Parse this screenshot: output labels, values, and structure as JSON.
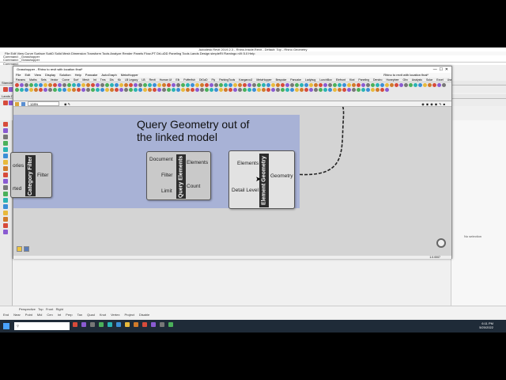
{
  "rhino": {
    "title": "Autodesk Revit 2019.2.3 - Rhino.Inside.Revit - Default: Top - Rhino Geometry",
    "menu": "File  Edit  View  Curve  Surface  SubD  Solid  Mesh  Dimension  Transform  Tools  Analyze  Render  Panels  Flow-PT  DrLuDD  Paneling Tools  Lands Design  simpleRI  Flamingo nXt 5.0  Help",
    "cmd_history": [
      "Command: _Grasshopper",
      "Command: _Grasshopper"
    ],
    "cmd_prompt": "Command:",
    "tabs": [
      "Standard",
      "CPlanes",
      "Set View",
      "Display",
      "Select",
      "Viewport Layout",
      "Visibility",
      "Transform",
      "Curve Tools",
      "Surface Tools",
      "Solid Tools",
      "SubD Tools",
      "Mesh Tools",
      "Render Tools",
      "Drafting",
      "New in V7"
    ],
    "subtabs": [
      "Lands Design",
      "Lands Objects",
      "Lands Documentation",
      "Lands Tools"
    ],
    "right_panel_text": "No selection",
    "osnap": [
      "End",
      "Near",
      "Point",
      "Mid",
      "Cen",
      "Int",
      "Perp",
      "Tan",
      "Quad",
      "Knot",
      "Vertex",
      "Project",
      "Disable"
    ],
    "view_tabs": [
      "Perspective",
      "Top",
      "Front",
      "Right"
    ],
    "clock": {
      "time": "6:11 PM",
      "date": "5/20/2022"
    }
  },
  "gh": {
    "title": "Grasshopper - Rhino to revit with location final*",
    "doc_name": "Rhino to revit with location final*",
    "menu": [
      "File",
      "Edit",
      "View",
      "Display",
      "Solution",
      "Help",
      "Pancake",
      "AutoGraph",
      "MetaHopper"
    ],
    "tabs": [
      "Params",
      "Maths",
      "Sets",
      "Vector",
      "Curve",
      "Surf",
      "Mesh",
      "Int",
      "Trns",
      "Dis",
      "Kk",
      "LB Legacy",
      "LB",
      "Revit",
      "Human UI",
      "Elk",
      "Pufferfish",
      "DiGaD",
      "Fly",
      "ParkingTools",
      "Kangaroo2",
      "MetaHopper",
      "Bespoke",
      "Pancake",
      "Ladybug",
      "LunchBox",
      "Elefront",
      "Kiwi",
      "Paneling",
      "Dendro",
      "Honeybee",
      "Ghx",
      "Analysis",
      "Solar",
      "Excel",
      "User"
    ],
    "zoom": "128%",
    "group_title": "Query Geometry out of the linked model",
    "components": {
      "category_filter": {
        "nick": "Category Filter",
        "inputs": [
          "ories"
        ],
        "outputs": [
          "Filter"
        ],
        "cut": "rted"
      },
      "query_elements": {
        "nick": "Query Elements",
        "inputs": [
          "Document",
          "Filter",
          "Limit"
        ],
        "outputs": [
          "Elements",
          "Count"
        ]
      },
      "element_geometry": {
        "nick": "Element Geometry",
        "inputs": [
          "Elements",
          "Detail Level"
        ],
        "outputs": [
          "Geometry"
        ]
      }
    },
    "version": "1.0.0007"
  },
  "colors": {
    "group": "#a8b2d6",
    "canvas": "#d4d4d4",
    "taskbar": "#1f2b38"
  }
}
